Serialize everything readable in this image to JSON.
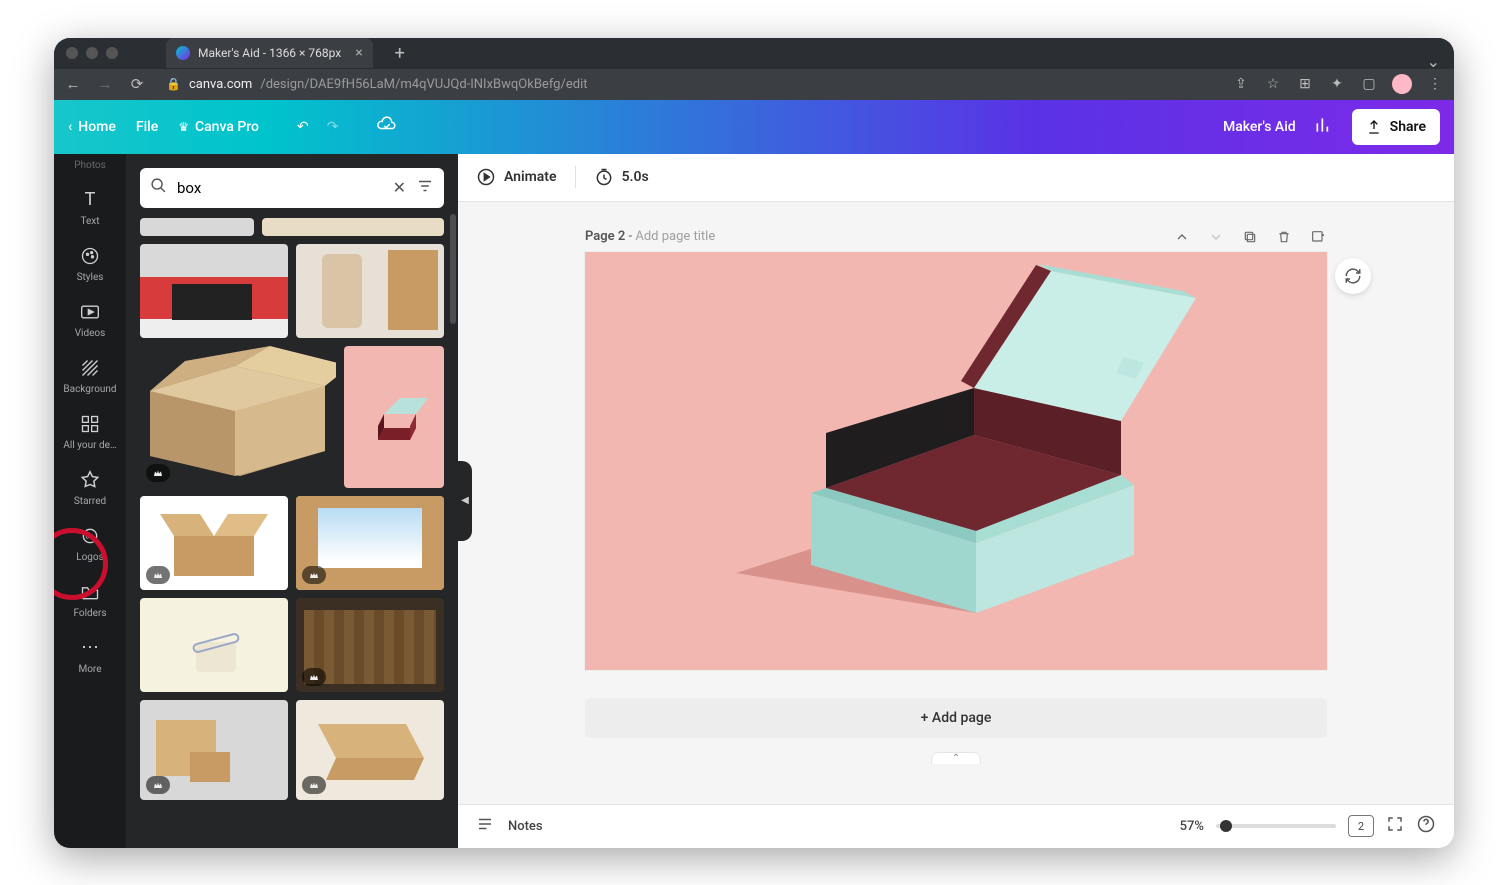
{
  "browser": {
    "tab_title": "Maker's Aid - 1366 × 768px",
    "url_host": "canva.com",
    "url_path": "/design/DAE9fH56LaM/m4qVUJQd-INIxBwqOkBefg/edit"
  },
  "toolbar": {
    "home": "Home",
    "file": "File",
    "pro": "Canva Pro",
    "doc_name": "Maker's Aid",
    "share": "Share"
  },
  "rail": {
    "items": [
      "Photos",
      "Text",
      "Styles",
      "Videos",
      "Background",
      "All your de…",
      "Starred",
      "Logos",
      "Folders",
      "More"
    ]
  },
  "search": {
    "value": "box"
  },
  "pagehdr": {
    "animate": "Animate",
    "duration": "5.0s"
  },
  "page": {
    "label": "Page 2",
    "sep": " - ",
    "placeholder": "Add page title",
    "add": "+ Add page"
  },
  "footer": {
    "notes": "Notes",
    "zoom": "57%",
    "page_count": "2"
  }
}
